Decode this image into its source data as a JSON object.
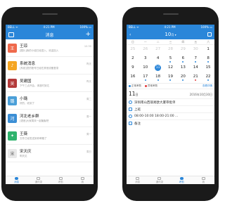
{
  "status": {
    "carrier": "BELL ᯤ",
    "time": "4:21 PM",
    "battery": "100% ▭"
  },
  "messages_screen": {
    "title": "消息",
    "add_glyph": "+",
    "messages": [
      {
        "name": "王琼",
        "subtitle": "[图片]我的小组已经进入，欢迎加入",
        "time": "10:30",
        "color": "#ef6a4c",
        "avatar": "王"
      },
      {
        "name": "系统消息",
        "subtitle": "[系统]您的账号已经在其他设备登录",
        "time": "昨天",
        "color": "#f5a623",
        "avatar": "♪"
      },
      {
        "name": "吴建国",
        "subtitle": "下午三点开会，请准时到达",
        "time": "昨天",
        "color": "#b33a3a",
        "avatar": "吴"
      },
      {
        "name": "小璐",
        "subtitle": "好的，收到了",
        "time": "周二",
        "color": "#4a9fd8",
        "avatar": "璐"
      },
      {
        "name": "河北老乡群",
        "subtitle": "[语音]大家周末一起聚聚吧",
        "time": "周一",
        "color": "#3b8ed5",
        "avatar": "河"
      },
      {
        "name": "王薇",
        "subtitle": "文件已经发送到你邮箱了",
        "time": "周一",
        "color": "#2fb36d",
        "avatar": "✦"
      },
      {
        "name": "宋天庆",
        "subtitle": "明天见",
        "time": "周日",
        "color": "#e8e8e8",
        "avatar": "宋"
      }
    ],
    "tabs": [
      {
        "label": "消息",
        "active": true
      },
      {
        "label": "通讯录",
        "active": false
      },
      {
        "label": "考勤",
        "active": false
      },
      {
        "label": "我",
        "active": false
      }
    ]
  },
  "calendar_screen": {
    "month": "10",
    "month_suffix": "月",
    "weekdays": [
      "日",
      "一",
      "二",
      "三",
      "四",
      "五",
      "六"
    ],
    "days": [
      {
        "n": "25",
        "dim": true,
        "dot": ""
      },
      {
        "n": "26",
        "dim": true,
        "dot": ""
      },
      {
        "n": "27",
        "dim": true,
        "dot": ""
      },
      {
        "n": "28",
        "dim": true,
        "dot": ""
      },
      {
        "n": "29",
        "dim": true,
        "dot": ""
      },
      {
        "n": "30",
        "dim": true,
        "dot": ""
      },
      {
        "n": "1",
        "dim": false,
        "dot": ""
      },
      {
        "n": "2",
        "dim": false,
        "dot": ""
      },
      {
        "n": "3",
        "dim": false,
        "dot": ""
      },
      {
        "n": "4",
        "dim": false,
        "dot": ""
      },
      {
        "n": "5",
        "dim": false,
        "dot": "#2a86d9"
      },
      {
        "n": "6",
        "dim": false,
        "dot": "#2a86d9"
      },
      {
        "n": "7",
        "dim": false,
        "dot": "#2a86d9"
      },
      {
        "n": "8",
        "dim": false,
        "dot": "#2a86d9"
      },
      {
        "n": "9",
        "dim": false,
        "dot": ""
      },
      {
        "n": "10",
        "dim": false,
        "dot": ""
      },
      {
        "n": "11",
        "dim": false,
        "dot": "",
        "selected": true
      },
      {
        "n": "12",
        "dim": false,
        "dot": ""
      },
      {
        "n": "13",
        "dim": false,
        "dot": ""
      },
      {
        "n": "14",
        "dim": false,
        "dot": ""
      },
      {
        "n": "15",
        "dim": false,
        "dot": ""
      },
      {
        "n": "16",
        "dim": false,
        "dot": ""
      },
      {
        "n": "17",
        "dim": false,
        "dot": "#2a86d9"
      },
      {
        "n": "18",
        "dim": false,
        "dot": "#2a86d9"
      },
      {
        "n": "19",
        "dim": false,
        "dot": "#2a86d9"
      },
      {
        "n": "20",
        "dim": false,
        "dot": "#2a86d9"
      },
      {
        "n": "21",
        "dim": false,
        "dot": "#e23b3b"
      },
      {
        "n": "22",
        "dim": false,
        "dot": "#2a86d9"
      }
    ],
    "legend": [
      {
        "label": "正常考勤",
        "color": "#2a86d9"
      },
      {
        "label": "异常考勤",
        "color": "#e23b3b"
      }
    ],
    "legend_link": "查看详情",
    "event_day": "11",
    "event_day_suffix": "日",
    "event_date": "2016年10月30日",
    "events": [
      {
        "text": "深圳南山西丽易欧大厦审批单",
        "icon": "location-icon"
      },
      {
        "text": "上班",
        "icon": "briefcase-icon"
      },
      {
        "text": "08:00-10:00 18:00-21:00 ...",
        "icon": "clock-icon"
      },
      {
        "text": "备注",
        "icon": "note-icon"
      }
    ],
    "tabs": [
      {
        "label": "消息",
        "active": false
      },
      {
        "label": "通讯录",
        "active": false
      },
      {
        "label": "考勤",
        "active": true
      },
      {
        "label": "我",
        "active": false
      }
    ]
  }
}
